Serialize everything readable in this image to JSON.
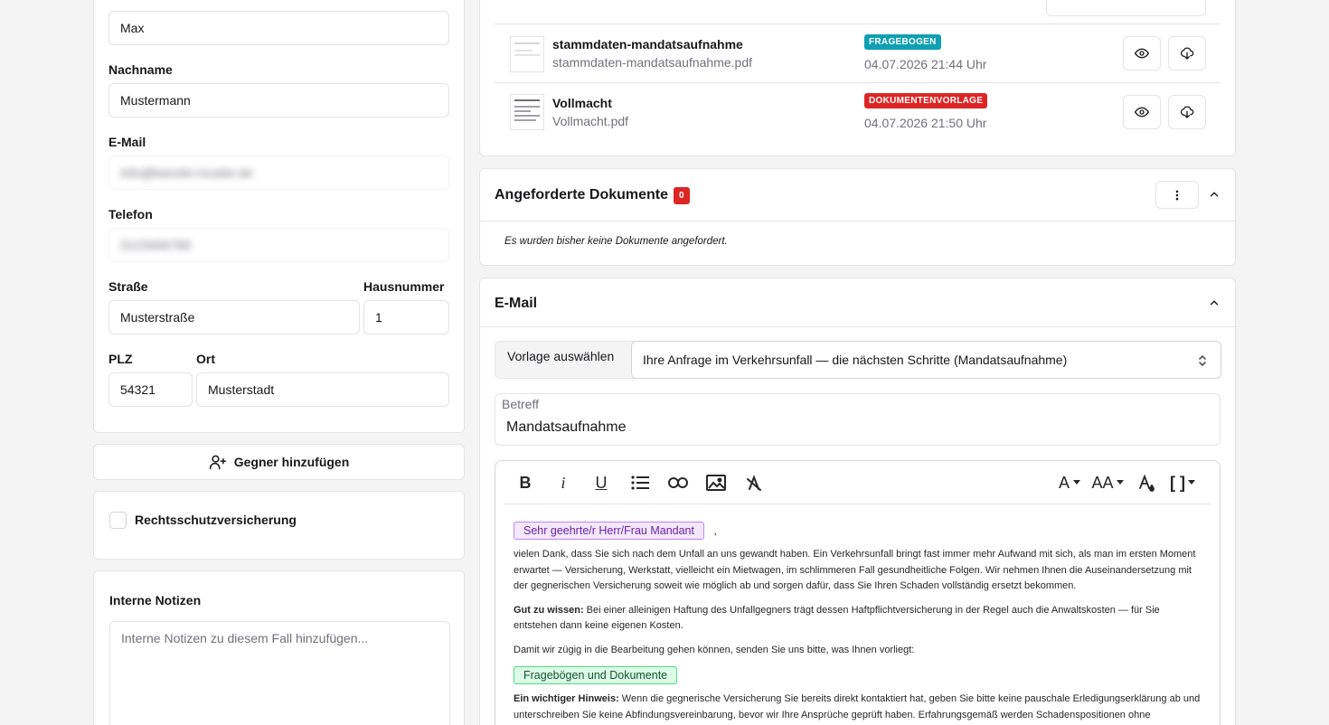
{
  "left": {
    "vorname_value": "Max",
    "nachname_label": "Nachname",
    "nachname_value": "Mustermann",
    "email_label": "E-Mail",
    "email_value": "info@kanzlei-muster.de",
    "telefon_label": "Telefon",
    "telefon_value": "0123456789",
    "strasse_label": "Straße",
    "strasse_value": "Musterstraße",
    "hausnummer_label": "Hausnummer",
    "hausnummer_value": "1",
    "plz_label": "PLZ",
    "plz_value": "54321",
    "ort_label": "Ort",
    "ort_value": "Musterstadt",
    "gegner_button": "Gegner hinzufügen",
    "rechtsschutz_label": "Rechtsschutzversicherung",
    "notizen_label": "Interne Notizen",
    "notizen_placeholder": "Interne Notizen zu diesem Fall hinzufügen..."
  },
  "documents": {
    "items": [
      {
        "title": "stammdaten-mandatsaufnahme",
        "filename": "stammdaten-mandatsaufnahme.pdf",
        "badge": "FRAGEBOGEN",
        "badge_color": "#0e9fb3",
        "date": "04.07.2026 21:44 Uhr"
      },
      {
        "title": "Vollmacht",
        "filename": "Vollmacht.pdf",
        "badge": "DOKUMENTENVORLAGE",
        "badge_color": "#dc2626",
        "date": "04.07.2026 21:50 Uhr"
      }
    ]
  },
  "requested": {
    "title": "Angeforderte Dokumente",
    "count": "0",
    "empty_text": "Es wurden bisher keine Dokumente angefordert."
  },
  "email": {
    "title": "E-Mail",
    "template_label": "Vorlage auswählen",
    "template_value": "Ihre Anfrage im Verkehrsunfall — die nächsten Schritte (Mandatsaufnahme)",
    "subject_label": "Betreff",
    "subject_value": "Mandatsaufnahme",
    "toolbar": {
      "bold": "B",
      "italic": "i",
      "underline": "U",
      "font_color": "A",
      "font_size": "AA",
      "placeholder": "[ ]"
    },
    "body": {
      "salutation_chip": "Sehr geehrte/r Herr/Frau Mandant",
      "salutation_suffix": ",",
      "p1": "vielen Dank, dass Sie sich nach dem Unfall an uns gewandt haben. Ein Verkehrsunfall bringt fast immer mehr Aufwand mit sich, als man im ersten Moment erwartet — Versicherung, Werkstatt, vielleicht ein Mietwagen, im schlimmeren Fall gesundheitliche Folgen. Wir nehmen Ihnen die Auseinandersetzung mit der gegnerischen Versicherung soweit wie möglich ab und sorgen dafür, dass Sie Ihren Schaden vollständig ersetzt bekommen.",
      "p2_bold": "Gut zu wissen:",
      "p2": " Bei einer alleinigen Haftung des Unfallgegners trägt dessen Haftpflichtversicherung in der Regel auch die Anwaltskosten — für Sie entstehen dann keine eigenen Kosten.",
      "p3": "Damit wir zügig in die Bearbeitung gehen können, senden Sie uns bitte, was Ihnen vorliegt:",
      "docs_chip": "Fragebögen und Dokumente",
      "p4_bold": "Ein wichtiger Hinweis:",
      "p4": " Wenn die gegnerische Versicherung Sie bereits direkt kontaktiert hat, geben Sie bitte keine pauschale Erledigungserklärung ab und unterschreiben Sie keine Abfindungsvereinbarung, bevor wir Ihre Ansprüche geprüft haben. Erfahrungsgemäß werden Schadenspositionen ohne"
    }
  },
  "colors": {
    "salutation_chip_bg": "#f3e8ff",
    "salutation_chip_border": "#c084fc",
    "docs_chip_bg": "#dcfce7",
    "docs_chip_border": "#4ade80"
  }
}
